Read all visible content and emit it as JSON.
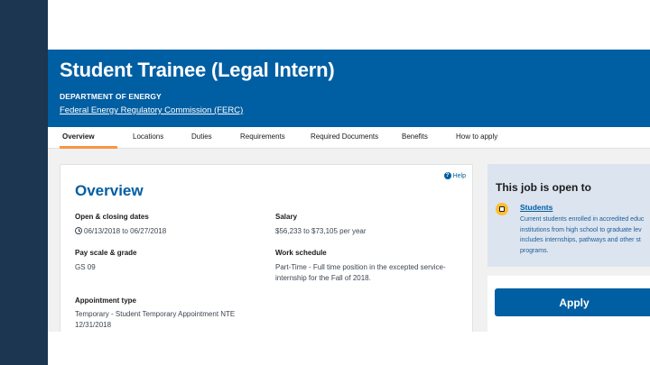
{
  "job": {
    "title": "Student Trainee (Legal Intern)",
    "department": "DEPARTMENT OF ENERGY",
    "agency": "Federal Energy Regulatory Commission (FERC)"
  },
  "tabs": [
    {
      "label": "Overview",
      "active": true
    },
    {
      "label": "Locations"
    },
    {
      "label": "Duties"
    },
    {
      "label": "Requirements"
    },
    {
      "label": "Required Documents"
    },
    {
      "label": "Benefits"
    },
    {
      "label": "How to apply"
    }
  ],
  "overview": {
    "title": "Overview",
    "help_label": "Help",
    "fields": {
      "dates": {
        "label": "Open & closing dates",
        "value": "06/13/2018 to 06/27/2018"
      },
      "salary": {
        "label": "Salary",
        "value": "$56,233 to $73,105 per year"
      },
      "pay_scale": {
        "label": "Pay scale & grade",
        "value": "GS 09"
      },
      "schedule": {
        "label": "Work schedule",
        "value": "Part-Time - Full time position in the excepted service- internship for the Fall of 2018."
      },
      "appointment": {
        "label": "Appointment type",
        "value": "Temporary - Student Temporary Appointment NTE 12/31/2018"
      }
    }
  },
  "open_to": {
    "title": "This job is open to",
    "group_label": "Students",
    "group_description": "Current students enrolled in accredited educ institutions from high school to graduate lev includes internships, pathways and other st programs."
  },
  "apply": {
    "label": "Apply"
  },
  "colors": {
    "header_blue": "#005ea2",
    "rail_navy": "#1c3550",
    "tab_accent": "#fa9441",
    "sidebar_blue": "#dce4ef",
    "student_badge": "#ffbe2e"
  }
}
